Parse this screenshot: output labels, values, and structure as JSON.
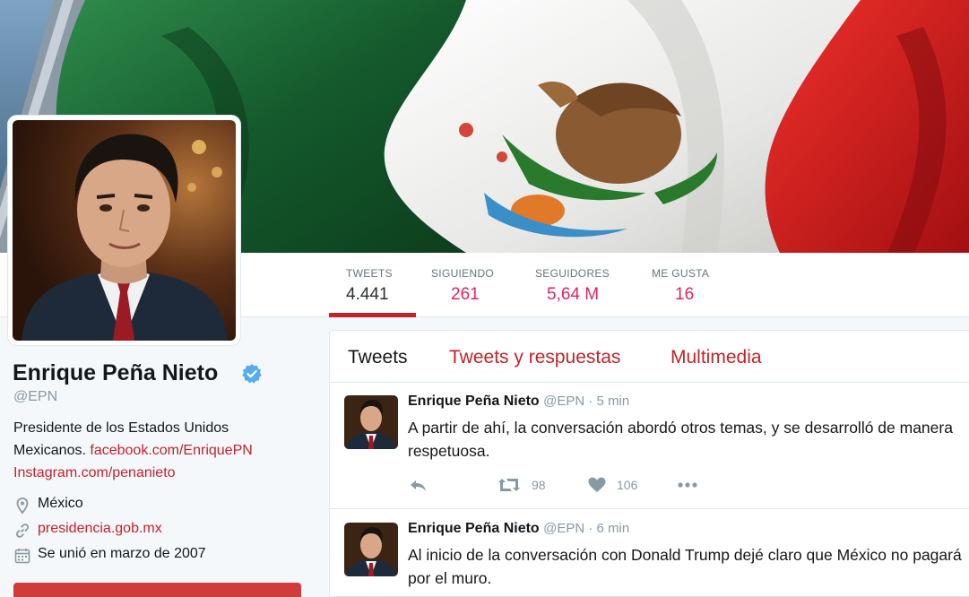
{
  "profile": {
    "name": "Enrique Peña Nieto",
    "handle": "@EPN",
    "bio_text": "Presidente de los Estados Unidos Mexicanos.",
    "bio_link_1": "facebook.com/EnriquePN",
    "bio_link_2": "Instagram.com/penanieto",
    "location": "México",
    "website": "presidencia.gob.mx",
    "joined": "Se unió en marzo de 2007",
    "verified": true
  },
  "stats": [
    {
      "label": "TWEETS",
      "value": "4.441"
    },
    {
      "label": "SIGUIENDO",
      "value": "261"
    },
    {
      "label": "SEGUIDORES",
      "value": "5,64 M"
    },
    {
      "label": "ME GUSTA",
      "value": "16"
    }
  ],
  "tabs": [
    {
      "label": "Tweets"
    },
    {
      "label": "Tweets y respuestas"
    },
    {
      "label": "Multimedia"
    }
  ],
  "tweets": [
    {
      "name": "Enrique Peña Nieto",
      "handle_time": "@EPN · 5 min",
      "text": "A partir de ahí, la conversación abordó otros temas, y se desarrolló de manera respetuosa.",
      "retweets": "98",
      "likes": "106"
    },
    {
      "name": "Enrique Peña Nieto",
      "handle_time": "@EPN · 6 min",
      "text": "Al inicio de la conversación con Donald Trump dejé claro que México no pagará por el muro."
    }
  ],
  "colors": {
    "accent": "#c0232b",
    "flag_green": "#1f6b3a",
    "flag_white": "#f2f2f0",
    "flag_red": "#d91e1e",
    "verified": "#55acee"
  },
  "icons": [
    "verified-icon",
    "location-icon",
    "link-icon",
    "calendar-icon",
    "reply-icon",
    "retweet-icon",
    "heart-icon",
    "more-icon"
  ]
}
